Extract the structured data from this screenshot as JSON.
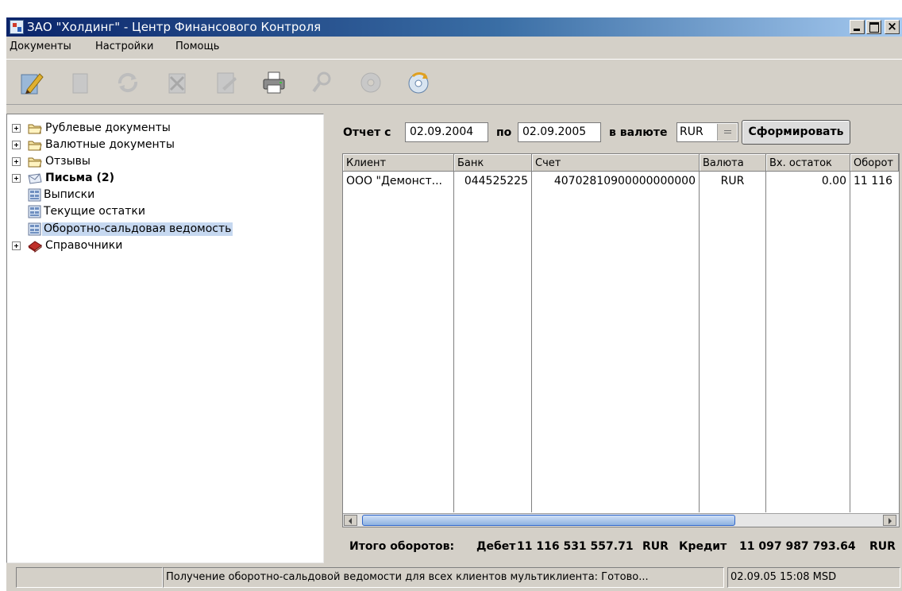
{
  "window": {
    "title": "ЗАО \"Холдинг\" - Центр Финансового Контроля",
    "icon": "app-icon"
  },
  "menu": [
    "Документы",
    "Настройки",
    "Помощь"
  ],
  "toolbar": [
    {
      "name": "edit-pencil-icon",
      "enabled": true
    },
    {
      "name": "new-document-icon",
      "enabled": false
    },
    {
      "name": "refresh-icon",
      "enabled": false
    },
    {
      "name": "delete-icon",
      "enabled": false
    },
    {
      "name": "sign-document-icon",
      "enabled": false
    },
    {
      "name": "print-icon",
      "enabled": true
    },
    {
      "name": "search-icon",
      "enabled": false
    },
    {
      "name": "disk-icon",
      "enabled": false
    },
    {
      "name": "disk-refresh-icon",
      "enabled": true
    }
  ],
  "tree": [
    {
      "label": "Рублевые документы",
      "icon": "folder-icon",
      "expander": true,
      "bold": false,
      "selected": false
    },
    {
      "label": "Валютные документы",
      "icon": "folder-icon",
      "expander": true,
      "bold": false,
      "selected": false
    },
    {
      "label": "Отзывы",
      "icon": "folder-icon",
      "expander": true,
      "bold": false,
      "selected": false
    },
    {
      "label": "Письма (2)",
      "icon": "letter-icon",
      "expander": true,
      "bold": true,
      "selected": false
    },
    {
      "label": "Выписки",
      "icon": "report-icon",
      "expander": false,
      "bold": false,
      "selected": false
    },
    {
      "label": "Текущие остатки",
      "icon": "report-icon",
      "expander": false,
      "bold": false,
      "selected": false
    },
    {
      "label": "Оборотно-сальдовая ведомость",
      "icon": "report-icon",
      "expander": false,
      "bold": false,
      "selected": true
    },
    {
      "label": "Справочники",
      "icon": "book-icon",
      "expander": true,
      "bold": false,
      "selected": false
    }
  ],
  "filter": {
    "from_label": "Отчет с",
    "from_date": "02.09.2004",
    "to_label": "по",
    "to_date": "02.09.2005",
    "currency_label": "в валюте",
    "currency": "RUR",
    "submit_label": "Сформировать"
  },
  "table": {
    "columns": [
      "Клиент",
      "Банк",
      "Счет",
      "Валюта",
      "Вх. остаток",
      "Оборот"
    ],
    "rows": [
      [
        "ООО \"Демонст...",
        "044525225",
        "40702810900000000000",
        "RUR",
        "0.00",
        "11 116"
      ]
    ]
  },
  "summary": {
    "title": "Итого оборотов:",
    "debit_label": "Дебет",
    "debit_value": "11 116 531 557.71",
    "debit_currency": "RUR",
    "credit_label": "Кредит",
    "credit_value": "11 097 987 793.64",
    "credit_currency": "RUR"
  },
  "status": {
    "left": "",
    "message": "Получение оборотно-сальдовой ведомости для всех клиентов мультиклиента: Готово...",
    "datetime": "02.09.05 15:08 MSD"
  }
}
